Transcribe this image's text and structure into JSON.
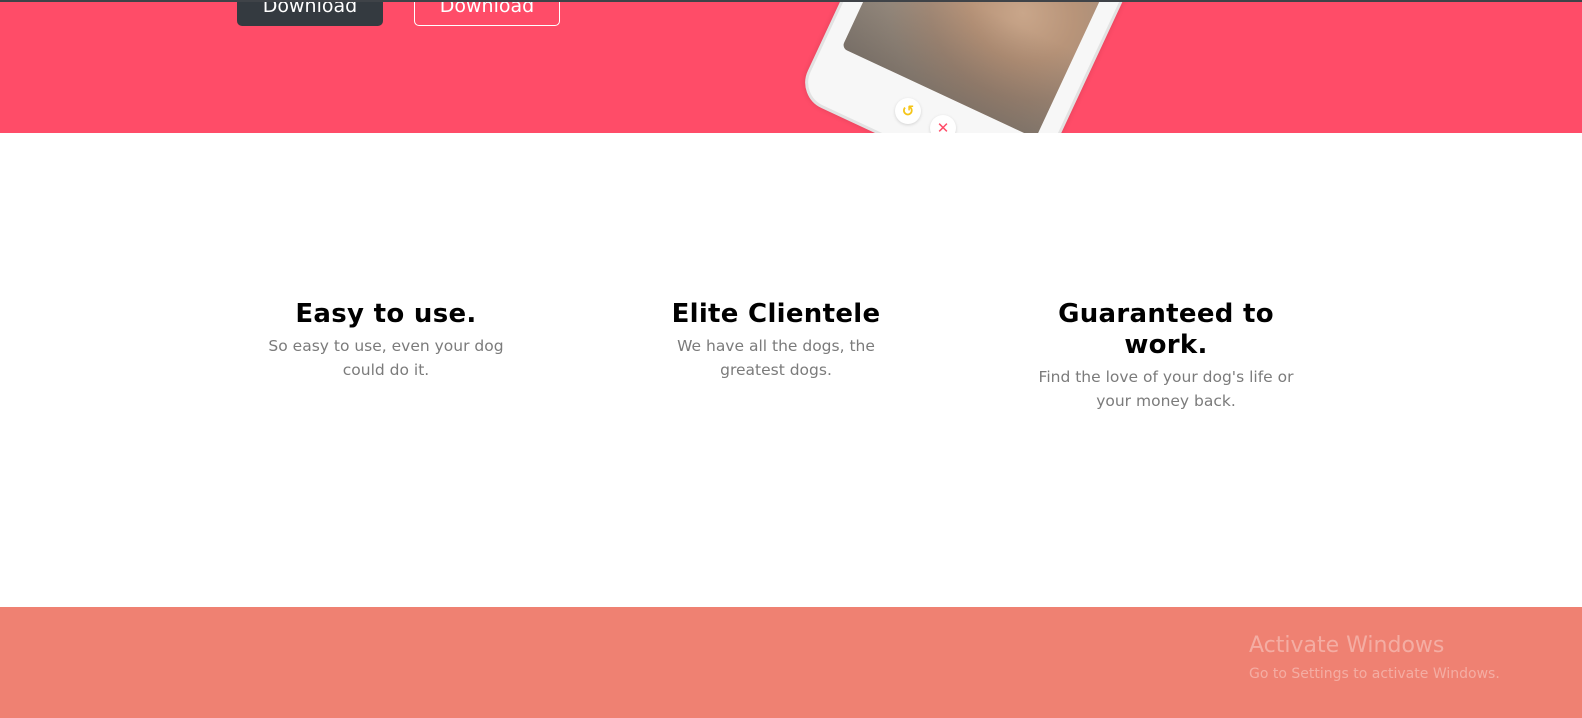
{
  "hero": {
    "background": "#ff4c68",
    "buttons": [
      {
        "label": "Download",
        "style": "dark"
      },
      {
        "label": "Download",
        "style": "outline"
      }
    ],
    "phone_actions": [
      {
        "icon": "undo-icon",
        "glyph": "↺",
        "color": "#f5c518"
      },
      {
        "icon": "close-icon",
        "glyph": "✕",
        "color": "#ff4c68"
      }
    ]
  },
  "features": [
    {
      "title": "Easy to use.",
      "text": "So easy to use, even your dog could do it."
    },
    {
      "title": "Elite Clientele",
      "text": "We have all the dogs, the greatest dogs."
    },
    {
      "title": "Guaranteed to work.",
      "text": "Find the love of your dog's life or your money back."
    }
  ],
  "footer": {
    "background": "#ef8172"
  },
  "watermark": {
    "title": "Activate Windows",
    "subtitle": "Go to Settings to activate Windows."
  }
}
